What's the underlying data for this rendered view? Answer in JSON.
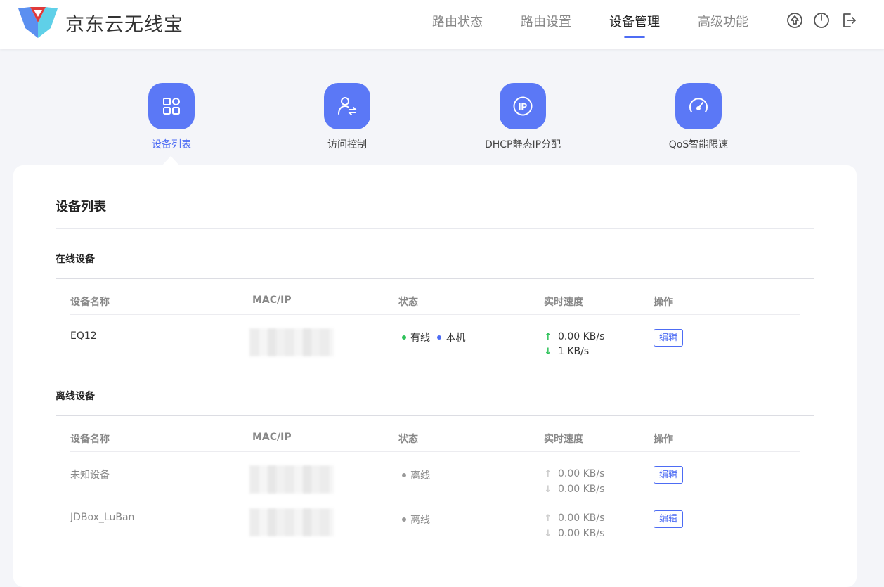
{
  "app": {
    "title": "京东云无线宝"
  },
  "nav": {
    "items": [
      "路由状态",
      "路由设置",
      "设备管理",
      "高级功能"
    ],
    "active": "设备管理"
  },
  "header_icons": [
    "upgrade-icon",
    "power-icon",
    "logout-icon"
  ],
  "tiles": [
    {
      "label": "设备列表",
      "icon": "grid-icon",
      "active": true
    },
    {
      "label": "访问控制",
      "icon": "user-swap-icon",
      "active": false
    },
    {
      "label": "DHCP静态IP分配",
      "icon": "ip-icon",
      "active": false
    },
    {
      "label": "QoS智能限速",
      "icon": "speedometer-icon",
      "active": false
    }
  ],
  "card": {
    "title": "设备列表"
  },
  "columns": [
    "设备名称",
    "MAC/IP",
    "状态",
    "实时速度",
    "操作"
  ],
  "online": {
    "title": "在线设备",
    "rows": [
      {
        "name": "EQ12",
        "status": "有线",
        "tag": "本机",
        "up": "0.00 KB/s",
        "down": "1 KB/s",
        "action": "编辑"
      }
    ]
  },
  "offline": {
    "title": "离线设备",
    "rows": [
      {
        "name": "未知设备",
        "status": "离线",
        "up": "0.00 KB/s",
        "down": "0.00 KB/s",
        "action": "编辑"
      },
      {
        "name": "JDBox_LuBan",
        "status": "离线",
        "up": "0.00 KB/s",
        "down": "0.00 KB/s",
        "action": "编辑"
      }
    ]
  },
  "colors": {
    "accent": "#4d6cf4",
    "tile_bg": "#5b78f6",
    "online_green": "#2fc25b",
    "self_blue": "#4d6cf4",
    "offline_gray": "#999999"
  }
}
